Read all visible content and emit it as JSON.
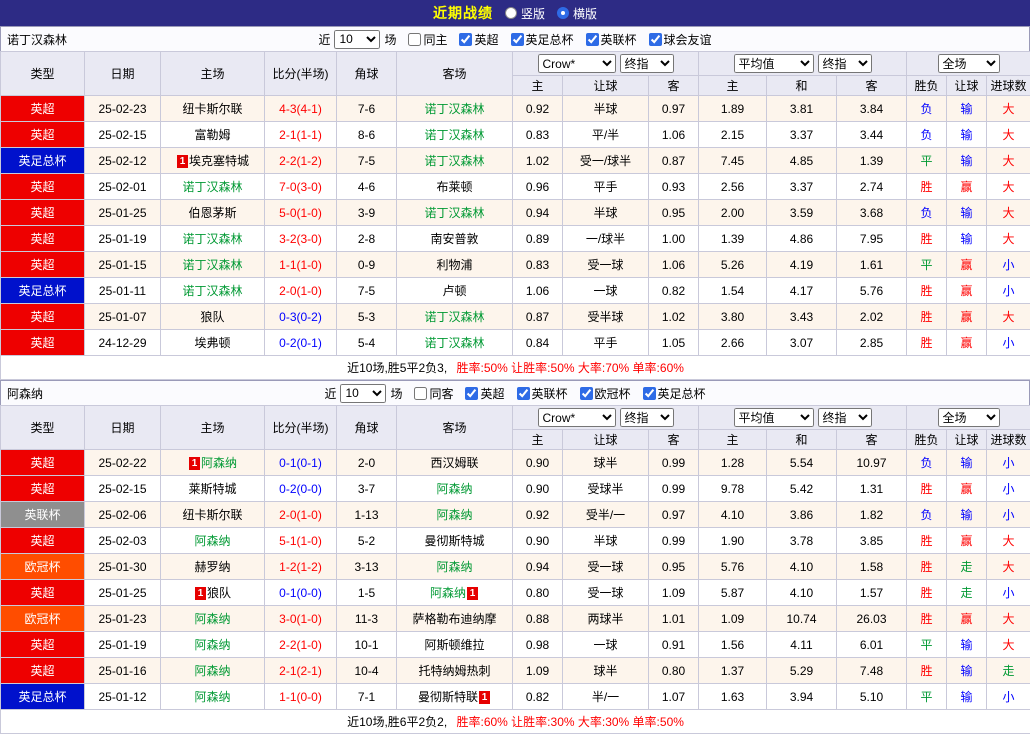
{
  "topbar": {
    "title": "近期战绩",
    "radios": [
      {
        "label": "竖版",
        "selected": false
      },
      {
        "label": "横版",
        "selected": true
      }
    ]
  },
  "colors": {
    "topbar_bg": "#2d2b85",
    "title_text": "#ffff00",
    "header_bg": "#e9e9f3",
    "row_alt_bg": "#fdf5ec",
    "summary_stats": "#ff0000"
  },
  "league_colors": {
    "英超": "#ee0000",
    "英足总杯": "#0011cc",
    "英联杯": "#8f8f8f",
    "欧冠杯": "#ff4d00"
  },
  "value_colors": {
    "r": "#ff0000",
    "b": "#0000ff",
    "g": "#009933",
    "team": "#009933"
  },
  "mark_text": "1",
  "table_header": {
    "static_cols": [
      "类型",
      "日期",
      "主场",
      "比分(半场)",
      "角球",
      "客场"
    ],
    "odds_selects": [
      "Crow*",
      "终指"
    ],
    "avg_selects": [
      "平均值",
      "终指"
    ],
    "scope_select": "全场",
    "sub_cols": [
      "主",
      "让球",
      "客",
      "主",
      "和",
      "客",
      "胜负",
      "让球",
      "进球数"
    ]
  },
  "sections": [
    {
      "team": "诺丁汉森林",
      "filter": {
        "near_label": "近",
        "count": "10",
        "games_label": "场",
        "same_label": "同主",
        "same_checked": false,
        "leagues": [
          {
            "label": "英超",
            "checked": true
          },
          {
            "label": "英足总杯",
            "checked": true
          },
          {
            "label": "英联杯",
            "checked": true
          },
          {
            "label": "球会友谊",
            "checked": true
          }
        ]
      },
      "rows": [
        {
          "league": "英超",
          "date": "25-02-23",
          "home": {
            "name": "纽卡斯尔联"
          },
          "score": {
            "text": "4-3(4-1)",
            "c": "r"
          },
          "corner": "7-6",
          "away": {
            "name": "诺丁汉森林",
            "green": true
          },
          "odds": [
            "0.92",
            "半球",
            "0.97"
          ],
          "avg": [
            "1.89",
            "3.81",
            "3.84"
          ],
          "res": [
            [
              "负",
              "b"
            ],
            [
              "输",
              "b"
            ],
            [
              "大",
              "r"
            ]
          ]
        },
        {
          "league": "英超",
          "date": "25-02-15",
          "home": {
            "name": "富勒姆"
          },
          "score": {
            "text": "2-1(1-1)",
            "c": "r"
          },
          "corner": "8-6",
          "away": {
            "name": "诺丁汉森林",
            "green": true
          },
          "odds": [
            "0.83",
            "平/半",
            "1.06"
          ],
          "avg": [
            "2.15",
            "3.37",
            "3.44"
          ],
          "res": [
            [
              "负",
              "b"
            ],
            [
              "输",
              "b"
            ],
            [
              "大",
              "r"
            ]
          ]
        },
        {
          "league": "英足总杯",
          "date": "25-02-12",
          "home": {
            "name": "埃克塞特城",
            "mark": "before"
          },
          "score": {
            "text": "2-2(1-2)",
            "c": "r"
          },
          "corner": "7-5",
          "away": {
            "name": "诺丁汉森林",
            "green": true
          },
          "odds": [
            "1.02",
            "受一/球半",
            "0.87"
          ],
          "avg": [
            "7.45",
            "4.85",
            "1.39"
          ],
          "res": [
            [
              "平",
              "g"
            ],
            [
              "输",
              "b"
            ],
            [
              "大",
              "r"
            ]
          ]
        },
        {
          "league": "英超",
          "date": "25-02-01",
          "home": {
            "name": "诺丁汉森林",
            "green": true
          },
          "score": {
            "text": "7-0(3-0)",
            "c": "r"
          },
          "corner": "4-6",
          "away": {
            "name": "布莱顿"
          },
          "odds": [
            "0.96",
            "平手",
            "0.93"
          ],
          "avg": [
            "2.56",
            "3.37",
            "2.74"
          ],
          "res": [
            [
              "胜",
              "r"
            ],
            [
              "赢",
              "r"
            ],
            [
              "大",
              "r"
            ]
          ]
        },
        {
          "league": "英超",
          "date": "25-01-25",
          "home": {
            "name": "伯恩茅斯"
          },
          "score": {
            "text": "5-0(1-0)",
            "c": "r"
          },
          "corner": "3-9",
          "away": {
            "name": "诺丁汉森林",
            "green": true
          },
          "odds": [
            "0.94",
            "半球",
            "0.95"
          ],
          "avg": [
            "2.00",
            "3.59",
            "3.68"
          ],
          "res": [
            [
              "负",
              "b"
            ],
            [
              "输",
              "b"
            ],
            [
              "大",
              "r"
            ]
          ]
        },
        {
          "league": "英超",
          "date": "25-01-19",
          "home": {
            "name": "诺丁汉森林",
            "green": true
          },
          "score": {
            "text": "3-2(3-0)",
            "c": "r"
          },
          "corner": "2-8",
          "away": {
            "name": "南安普敦"
          },
          "odds": [
            "0.89",
            "一/球半",
            "1.00"
          ],
          "avg": [
            "1.39",
            "4.86",
            "7.95"
          ],
          "res": [
            [
              "胜",
              "r"
            ],
            [
              "输",
              "b"
            ],
            [
              "大",
              "r"
            ]
          ]
        },
        {
          "league": "英超",
          "date": "25-01-15",
          "home": {
            "name": "诺丁汉森林",
            "green": true
          },
          "score": {
            "text": "1-1(1-0)",
            "c": "r"
          },
          "corner": "0-9",
          "away": {
            "name": "利物浦"
          },
          "odds": [
            "0.83",
            "受一球",
            "1.06"
          ],
          "avg": [
            "5.26",
            "4.19",
            "1.61"
          ],
          "res": [
            [
              "平",
              "g"
            ],
            [
              "赢",
              "r"
            ],
            [
              "小",
              "b"
            ]
          ]
        },
        {
          "league": "英足总杯",
          "date": "25-01-11",
          "home": {
            "name": "诺丁汉森林",
            "green": true
          },
          "score": {
            "text": "2-0(1-0)",
            "c": "r"
          },
          "corner": "7-5",
          "away": {
            "name": "卢顿"
          },
          "odds": [
            "1.06",
            "一球",
            "0.82"
          ],
          "avg": [
            "1.54",
            "4.17",
            "5.76"
          ],
          "res": [
            [
              "胜",
              "r"
            ],
            [
              "赢",
              "r"
            ],
            [
              "小",
              "b"
            ]
          ]
        },
        {
          "league": "英超",
          "date": "25-01-07",
          "home": {
            "name": "狼队"
          },
          "score": {
            "text": "0-3(0-2)",
            "c": "b"
          },
          "corner": "5-3",
          "away": {
            "name": "诺丁汉森林",
            "green": true
          },
          "odds": [
            "0.87",
            "受半球",
            "1.02"
          ],
          "avg": [
            "3.80",
            "3.43",
            "2.02"
          ],
          "res": [
            [
              "胜",
              "r"
            ],
            [
              "赢",
              "r"
            ],
            [
              "大",
              "r"
            ]
          ]
        },
        {
          "league": "英超",
          "date": "24-12-29",
          "home": {
            "name": "埃弗顿"
          },
          "score": {
            "text": "0-2(0-1)",
            "c": "b"
          },
          "corner": "5-4",
          "away": {
            "name": "诺丁汉森林",
            "green": true
          },
          "odds": [
            "0.84",
            "平手",
            "1.05"
          ],
          "avg": [
            "2.66",
            "3.07",
            "2.85"
          ],
          "res": [
            [
              "胜",
              "r"
            ],
            [
              "赢",
              "r"
            ],
            [
              "小",
              "b"
            ]
          ]
        }
      ],
      "summary_prefix": "近10场,胜5平2负3,",
      "summary_stats": "胜率:50% 让胜率:50% 大率:70% 单率:60%"
    },
    {
      "team": "阿森纳",
      "filter": {
        "near_label": "近",
        "count": "10",
        "games_label": "场",
        "same_label": "同客",
        "same_checked": false,
        "leagues": [
          {
            "label": "英超",
            "checked": true
          },
          {
            "label": "英联杯",
            "checked": true
          },
          {
            "label": "欧冠杯",
            "checked": true
          },
          {
            "label": "英足总杯",
            "checked": true
          }
        ]
      },
      "rows": [
        {
          "league": "英超",
          "date": "25-02-22",
          "home": {
            "name": "阿森纳",
            "green": true,
            "mark": "before"
          },
          "score": {
            "text": "0-1(0-1)",
            "c": "b"
          },
          "corner": "2-0",
          "away": {
            "name": "西汉姆联"
          },
          "odds": [
            "0.90",
            "球半",
            "0.99"
          ],
          "avg": [
            "1.28",
            "5.54",
            "10.97"
          ],
          "res": [
            [
              "负",
              "b"
            ],
            [
              "输",
              "b"
            ],
            [
              "小",
              "b"
            ]
          ]
        },
        {
          "league": "英超",
          "date": "25-02-15",
          "home": {
            "name": "莱斯特城"
          },
          "score": {
            "text": "0-2(0-0)",
            "c": "b"
          },
          "corner": "3-7",
          "away": {
            "name": "阿森纳",
            "green": true
          },
          "odds": [
            "0.90",
            "受球半",
            "0.99"
          ],
          "avg": [
            "9.78",
            "5.42",
            "1.31"
          ],
          "res": [
            [
              "胜",
              "r"
            ],
            [
              "赢",
              "r"
            ],
            [
              "小",
              "b"
            ]
          ]
        },
        {
          "league": "英联杯",
          "date": "25-02-06",
          "home": {
            "name": "纽卡斯尔联"
          },
          "score": {
            "text": "2-0(1-0)",
            "c": "r"
          },
          "corner": "1-13",
          "away": {
            "name": "阿森纳",
            "green": true
          },
          "odds": [
            "0.92",
            "受半/一",
            "0.97"
          ],
          "avg": [
            "4.10",
            "3.86",
            "1.82"
          ],
          "res": [
            [
              "负",
              "b"
            ],
            [
              "输",
              "b"
            ],
            [
              "小",
              "b"
            ]
          ]
        },
        {
          "league": "英超",
          "date": "25-02-03",
          "home": {
            "name": "阿森纳",
            "green": true
          },
          "score": {
            "text": "5-1(1-0)",
            "c": "r"
          },
          "corner": "5-2",
          "away": {
            "name": "曼彻斯特城"
          },
          "odds": [
            "0.90",
            "半球",
            "0.99"
          ],
          "avg": [
            "1.90",
            "3.78",
            "3.85"
          ],
          "res": [
            [
              "胜",
              "r"
            ],
            [
              "赢",
              "r"
            ],
            [
              "大",
              "r"
            ]
          ]
        },
        {
          "league": "欧冠杯",
          "date": "25-01-30",
          "home": {
            "name": "赫罗纳"
          },
          "score": {
            "text": "1-2(1-2)",
            "c": "r"
          },
          "corner": "3-13",
          "away": {
            "name": "阿森纳",
            "green": true
          },
          "odds": [
            "0.94",
            "受一球",
            "0.95"
          ],
          "avg": [
            "5.76",
            "4.10",
            "1.58"
          ],
          "res": [
            [
              "胜",
              "r"
            ],
            [
              "走",
              "g"
            ],
            [
              "大",
              "r"
            ]
          ]
        },
        {
          "league": "英超",
          "date": "25-01-25",
          "home": {
            "name": "狼队",
            "mark": "before"
          },
          "score": {
            "text": "0-1(0-0)",
            "c": "b"
          },
          "corner": "1-5",
          "away": {
            "name": "阿森纳",
            "green": true,
            "mark": "after"
          },
          "odds": [
            "0.80",
            "受一球",
            "1.09"
          ],
          "avg": [
            "5.87",
            "4.10",
            "1.57"
          ],
          "res": [
            [
              "胜",
              "r"
            ],
            [
              "走",
              "g"
            ],
            [
              "小",
              "b"
            ]
          ]
        },
        {
          "league": "欧冠杯",
          "date": "25-01-23",
          "home": {
            "name": "阿森纳",
            "green": true
          },
          "score": {
            "text": "3-0(1-0)",
            "c": "r"
          },
          "corner": "11-3",
          "away": {
            "name": "萨格勒布迪纳摩"
          },
          "odds": [
            "0.88",
            "两球半",
            "1.01"
          ],
          "avg": [
            "1.09",
            "10.74",
            "26.03"
          ],
          "res": [
            [
              "胜",
              "r"
            ],
            [
              "赢",
              "r"
            ],
            [
              "大",
              "r"
            ]
          ]
        },
        {
          "league": "英超",
          "date": "25-01-19",
          "home": {
            "name": "阿森纳",
            "green": true
          },
          "score": {
            "text": "2-2(1-0)",
            "c": "r"
          },
          "corner": "10-1",
          "away": {
            "name": "阿斯顿维拉"
          },
          "odds": [
            "0.98",
            "一球",
            "0.91"
          ],
          "avg": [
            "1.56",
            "4.11",
            "6.01"
          ],
          "res": [
            [
              "平",
              "g"
            ],
            [
              "输",
              "b"
            ],
            [
              "大",
              "r"
            ]
          ]
        },
        {
          "league": "英超",
          "date": "25-01-16",
          "home": {
            "name": "阿森纳",
            "green": true
          },
          "score": {
            "text": "2-1(2-1)",
            "c": "r"
          },
          "corner": "10-4",
          "away": {
            "name": "托特纳姆热刺"
          },
          "odds": [
            "1.09",
            "球半",
            "0.80"
          ],
          "avg": [
            "1.37",
            "5.29",
            "7.48"
          ],
          "res": [
            [
              "胜",
              "r"
            ],
            [
              "输",
              "b"
            ],
            [
              "走",
              "g"
            ]
          ]
        },
        {
          "league": "英足总杯",
          "date": "25-01-12",
          "home": {
            "name": "阿森纳",
            "green": true
          },
          "score": {
            "text": "1-1(0-0)",
            "c": "r"
          },
          "corner": "7-1",
          "away": {
            "name": "曼彻斯特联",
            "mark": "after"
          },
          "odds": [
            "0.82",
            "半/一",
            "1.07"
          ],
          "avg": [
            "1.63",
            "3.94",
            "5.10"
          ],
          "res": [
            [
              "平",
              "g"
            ],
            [
              "输",
              "b"
            ],
            [
              "小",
              "b"
            ]
          ]
        }
      ],
      "summary_prefix": "近10场,胜6平2负2,",
      "summary_stats": "胜率:60% 让胜率:30% 大率:30% 单率:50%"
    }
  ]
}
